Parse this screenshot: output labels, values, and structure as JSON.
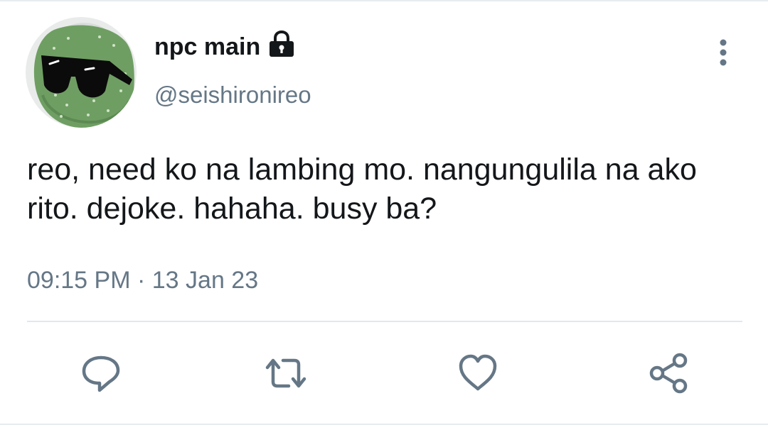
{
  "user": {
    "display_name": "npc main",
    "handle": "@seishironireo",
    "protected": true,
    "avatar_icon": "cactus-sunglasses-avatar"
  },
  "tweet": {
    "text": "reo, need ko na lambing mo. nangungulila na ako rito. dejoke. hahaha. busy ba?",
    "time": "09:15 PM",
    "separator": "·",
    "date": "13 Jan 23"
  },
  "actions": [
    {
      "icon": "reply-icon"
    },
    {
      "icon": "retweet-icon"
    },
    {
      "icon": "like-icon"
    },
    {
      "icon": "share-icon"
    }
  ],
  "colors": {
    "text_primary": "#14171a",
    "text_secondary": "#657786",
    "icon": "#657786",
    "divider": "#e1e8ed",
    "avatar_bg": "#6f9e63"
  }
}
